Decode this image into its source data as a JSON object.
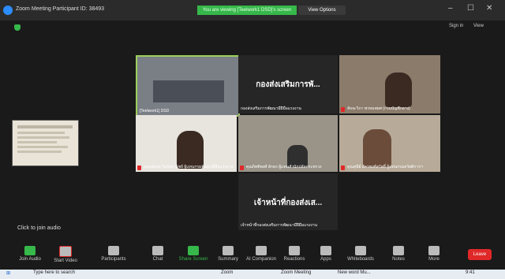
{
  "titlebar": {
    "title": "Zoom Meeting Participant ID: 38493",
    "banner": "You are viewing [Teelwork1 DSD]'s screen",
    "view_options": "View Options",
    "minimize": "–",
    "maximize": "☐",
    "close": "✕"
  },
  "secbar": {
    "signin": "Sign in",
    "view": "View"
  },
  "tiles": [
    {
      "label": "[Teelwork1] DSD",
      "type": "video"
    },
    {
      "name": "กองส่งเสริมการพั...",
      "label": "กองส่งเสริมการพัฒนามีฝีมือแรงงาน",
      "type": "name"
    },
    {
      "label": "สัจจะวิภา พรหมพยศ (กรมบัญชีกลาง)",
      "type": "video"
    },
    {
      "label": "คุณณัฐพล วิเศษพานิชย์ ผู้แทนกรมพัฒนาฝีมือแรงงาน",
      "type": "video"
    },
    {
      "label": "คุณกิตติพงศ์ อักษร ผู้แทนสำนักปลัดกระทรวง",
      "type": "video"
    },
    {
      "label": "คุณสุนีย์ อัครพงศ์สวัสดิ์ ผู้แทนกรมสวัสดิการฯ",
      "type": "video"
    },
    {
      "name": "เจ้าหน้าที่กองส่งเส...",
      "label": "เจ้าหน้าที่กองส่งเสริมการพัฒนามีฝีมือแรงงาน",
      "type": "name"
    }
  ],
  "click_to_join": "Click to join audio",
  "toolbar": [
    {
      "label": "Join Audio",
      "icon": "headphones-icon"
    },
    {
      "label": "Start Video",
      "icon": "video-off-icon"
    },
    {
      "label": "Participants",
      "icon": "participants-icon"
    },
    {
      "label": "Chat",
      "icon": "chat-icon"
    },
    {
      "label": "Share Screen",
      "icon": "share-screen-icon"
    },
    {
      "label": "Summary",
      "icon": "summary-icon"
    },
    {
      "label": "AI Companion",
      "icon": "ai-companion-icon"
    },
    {
      "label": "Reactions",
      "icon": "reactions-icon"
    },
    {
      "label": "Apps",
      "icon": "apps-icon"
    },
    {
      "label": "Whiteboards",
      "icon": "whiteboard-icon"
    },
    {
      "label": "Notes",
      "icon": "notes-icon"
    },
    {
      "label": "More",
      "icon": "more-icon"
    }
  ],
  "leave": "Leave",
  "taskbar": {
    "search": "Type here to search",
    "zoom": "Zoom",
    "zoom_meeting": "Zoom Meeting",
    "word": "New word Mu...",
    "time": "9:41"
  },
  "colors": {
    "accent": "#2d8cff",
    "banner": "#36b84a",
    "leave": "#e02828"
  }
}
